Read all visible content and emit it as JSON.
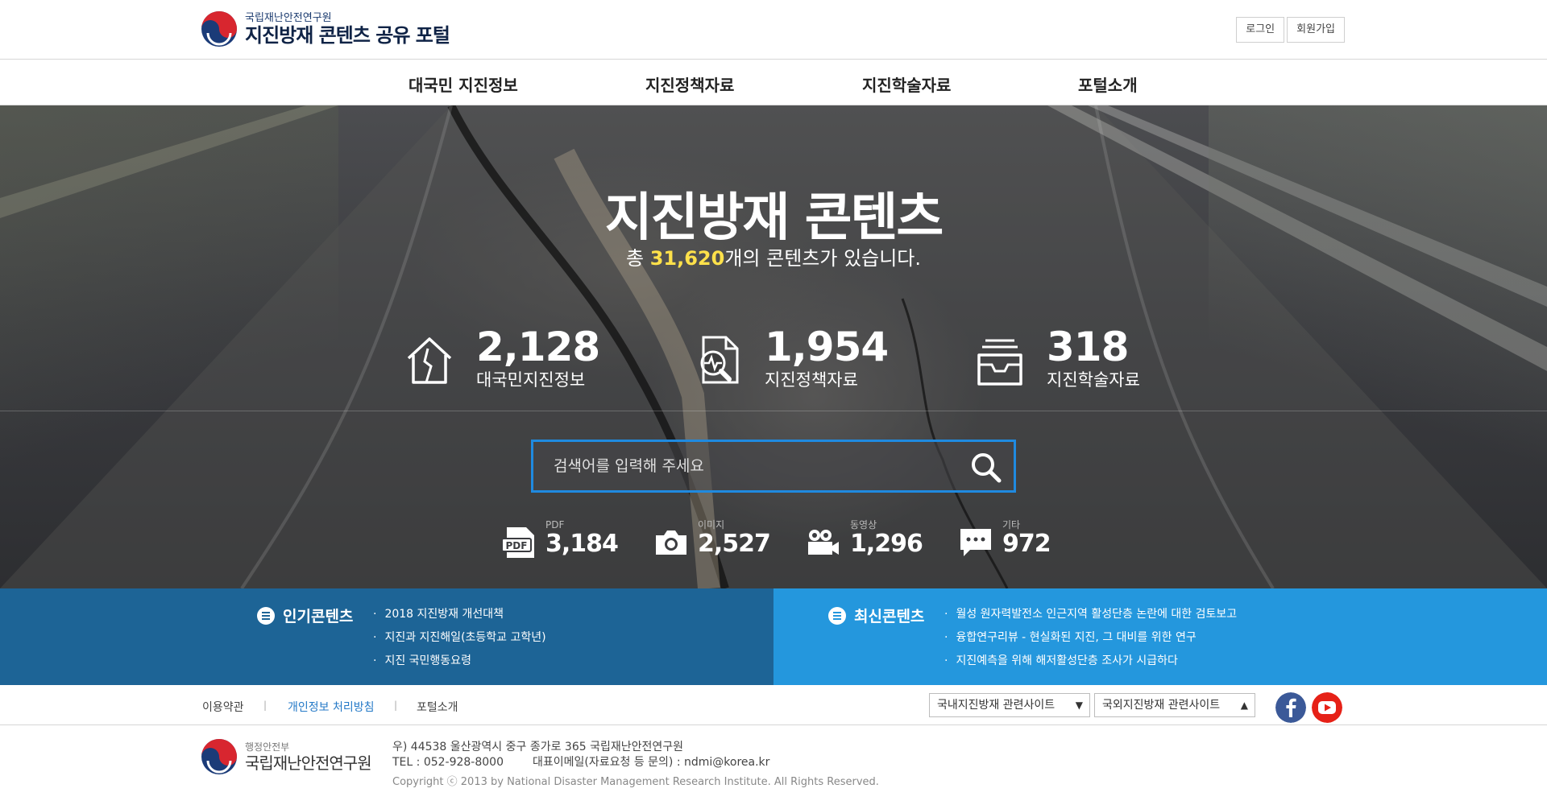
{
  "header": {
    "logo_sub": "국립재난안전연구원",
    "logo_main": "지진방재 콘텐츠 공유 포털",
    "login": "로그인",
    "signup": "회원가입"
  },
  "nav": [
    "대국민 지진정보",
    "지진정책자료",
    "지진학술자료",
    "포털소개"
  ],
  "hero": {
    "title": "지진방재 콘텐츠",
    "sub_prefix": "총 ",
    "sub_count": "31,620",
    "sub_suffix": "개의 콘텐츠가 있습니다.",
    "stats": [
      {
        "value": "2,128",
        "label": "대국민지진정보",
        "icon": "cracked-house-icon"
      },
      {
        "value": "1,954",
        "label": "지진정책자료",
        "icon": "document-search-icon"
      },
      {
        "value": "318",
        "label": "지진학술자료",
        "icon": "archive-tray-icon"
      }
    ],
    "search_placeholder": "검색어를 입력해 주세요",
    "types": [
      {
        "caption": "PDF",
        "value": "3,184",
        "icon": "pdf-icon"
      },
      {
        "caption": "이미지",
        "value": "2,527",
        "icon": "camera-icon"
      },
      {
        "caption": "동영상",
        "value": "1,296",
        "icon": "video-camera-icon"
      },
      {
        "caption": "기타",
        "value": "972",
        "icon": "chat-bubble-icon"
      }
    ]
  },
  "popular": {
    "title": "인기콘텐츠",
    "items": [
      "2018 지진방재 개선대책",
      "지진과 지진해일(초등학교 고학년)",
      "지진 국민행동요령"
    ]
  },
  "latest": {
    "title": "최신콘텐츠",
    "items": [
      "월성 원자력발전소 인근지역 활성단층 논란에 대한 검토보고",
      "융합연구리뷰 - 현실화된 지진, 그 대비를 위한 연구",
      "지진예측을 위해 해저활성단층 조사가 시급하다"
    ]
  },
  "links": {
    "terms": "이용약관",
    "privacy": "개인정보 처리방침",
    "about": "포털소개",
    "select_domestic": "국내지진방재 관련사이트",
    "select_foreign": "국외지진방재 관련사이트"
  },
  "footer": {
    "ministry": "행정안전부",
    "institute": "국립재난안전연구원",
    "address": "우) 44538 울산광역시 중구 종가로 365 국립재난안전연구원",
    "tel": "TEL : 052-928-8000",
    "email": "대표이메일(자료요청 등 문의) : ndmi@korea.kr",
    "copyright": "Copyright ⓒ 2013 by National Disaster Management Research Institute. All Rights Reserved."
  },
  "colors": {
    "accent_yellow": "#ffe14a",
    "popular_bg": "#1d6496",
    "latest_bg": "#2497dd",
    "search_border": "#1f8ae0",
    "facebook": "#3b5998",
    "youtube": "#e62117"
  }
}
